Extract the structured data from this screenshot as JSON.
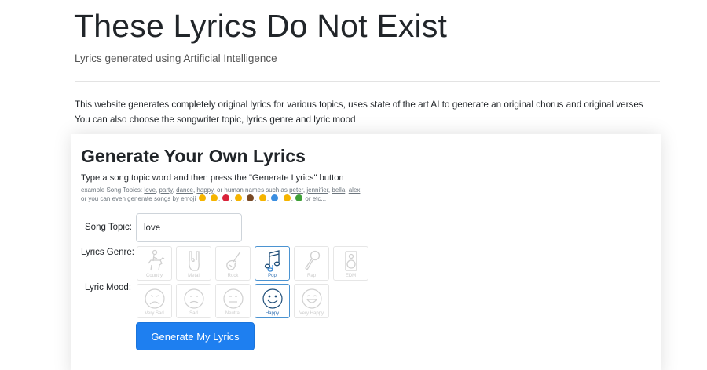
{
  "header": {
    "title": "These Lyrics Do Not Exist",
    "subtitle": "Lyrics generated using Artificial Intelligence"
  },
  "intro": {
    "line1": "This website generates completely original lyrics for various topics, uses state of the art AI to generate an original chorus and original verses",
    "line2": "You can also choose the songwriter topic, lyrics genre and lyric mood"
  },
  "generator": {
    "title": "Generate Your Own Lyrics",
    "description": "Type a song topic word and then press the \"Generate Lyrics\" button",
    "examples": {
      "prefix": "example Song Topics: ",
      "topics": [
        "love",
        "party",
        "dance",
        "happy"
      ],
      "middle": ", or human names such as ",
      "names": [
        "peter",
        "jennifier",
        "bella",
        "alex"
      ],
      "line2_prefix": "or you can even generate songs by emoji ",
      "line2_suffix": " or etc..."
    },
    "emoji_colors": [
      "#f5b400",
      "#f5b400",
      "#d9233a",
      "#f5b400",
      "#7a4a25",
      "#f5b400",
      "#3b8ee0",
      "#f5b400",
      "#3fa037"
    ],
    "song_topic": {
      "label": "Song Topic:",
      "value": "love"
    },
    "genre": {
      "label": "Lyrics Genre:",
      "options": [
        {
          "label": "Country",
          "icon": "horse-rider-icon",
          "selected": false
        },
        {
          "label": "Metal",
          "icon": "rock-hand-icon",
          "selected": false
        },
        {
          "label": "Rock",
          "icon": "electric-guitar-icon",
          "selected": false
        },
        {
          "label": "Pop",
          "icon": "music-notes-icon",
          "selected": true
        },
        {
          "label": "Rap",
          "icon": "microphone-icon",
          "selected": false
        },
        {
          "label": "EDM",
          "icon": "speaker-icon",
          "selected": false
        }
      ]
    },
    "mood": {
      "label": "Lyric Mood:",
      "options": [
        {
          "label": "Very Sad",
          "icon": "very-sad-face-icon",
          "selected": false
        },
        {
          "label": "Sad",
          "icon": "sad-face-icon",
          "selected": false
        },
        {
          "label": "Neutral",
          "icon": "neutral-face-icon",
          "selected": false
        },
        {
          "label": "Happy",
          "icon": "happy-face-icon",
          "selected": true
        },
        {
          "label": "Very Happy",
          "icon": "very-happy-face-icon",
          "selected": false
        }
      ]
    },
    "button_label": "Generate My Lyrics"
  },
  "colors": {
    "accent": "#1e7ff0",
    "selected_border": "#4b93d1"
  }
}
